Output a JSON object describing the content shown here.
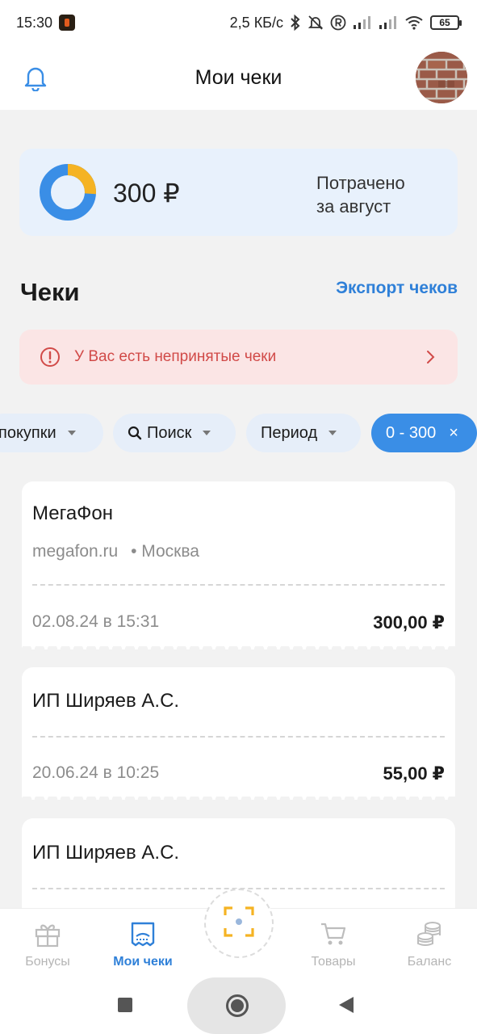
{
  "status_bar": {
    "time": "15:30",
    "speed": "2,5 КБ/с",
    "battery": "65",
    "icons": [
      "app-icon",
      "bluetooth-icon",
      "mute-icon",
      "registered-icon",
      "signal-icon",
      "signal-icon",
      "wifi-icon",
      "battery-icon"
    ]
  },
  "header": {
    "title": "Мои чеки",
    "left_icon": "bell-icon",
    "avatar_icon": "avatar-brick-image"
  },
  "summary": {
    "amount": "300 ₽",
    "label_line1": "Потрачено",
    "label_line2": "за август",
    "donut_fraction_orange": 0.26,
    "colors": {
      "blue": "#3a8ee6",
      "orange": "#f5b323"
    }
  },
  "section": {
    "title": "Чеки",
    "export_label": "Экспорт чеков"
  },
  "alert": {
    "text": "У Вас есть непринятые чеки",
    "icon": "alert-circle-icon",
    "chevron": "chevron-right-icon"
  },
  "filters": [
    {
      "label": "покупки",
      "has_caret": true
    },
    {
      "label": "Поиск",
      "has_caret": true,
      "icon": "search-icon"
    },
    {
      "label": "Период",
      "has_caret": true
    },
    {
      "label": "0 - 300",
      "active": true,
      "close": "×"
    }
  ],
  "receipts": [
    {
      "name": "МегаФон",
      "site": "megafon.ru",
      "city": "• Москва",
      "date": "02.08.24 в 15:31",
      "amount": "300,00 ₽"
    },
    {
      "name": "ИП Ширяев А.С.",
      "date": "20.06.24 в 10:25",
      "amount": "55,00 ₽"
    },
    {
      "name": "ИП Ширяев А.С."
    }
  ],
  "bottom_nav": [
    {
      "label": "Бонусы",
      "icon": "gift-icon"
    },
    {
      "label": "Мои чеки",
      "icon": "receipt-icon",
      "active": true
    },
    {
      "label": "",
      "icon": "scan-icon"
    },
    {
      "label": "Товары",
      "icon": "cart-icon"
    },
    {
      "label": "Баланс",
      "icon": "coins-icon"
    }
  ],
  "colors": {
    "accent": "#2f80d8",
    "alert_text": "#d14a48",
    "alert_bg": "#fbe5e5",
    "card_bg": "#e8f1fc"
  }
}
